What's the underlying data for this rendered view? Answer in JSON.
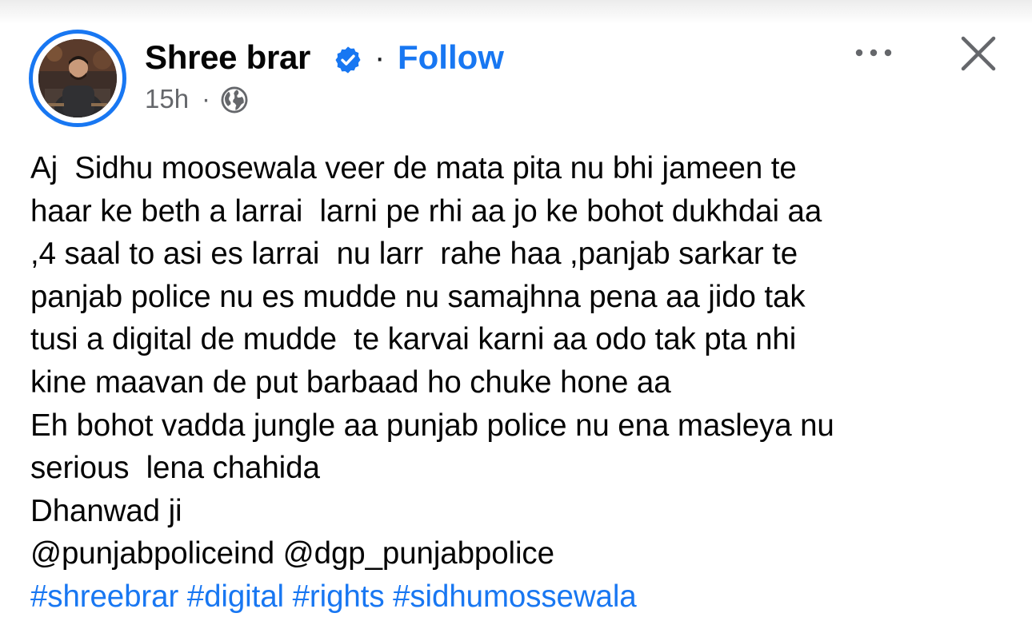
{
  "post": {
    "author": {
      "name": "Shree brar",
      "verified": true,
      "avatar_icon": "profile-photo"
    },
    "follow_label": "Follow",
    "separator": "·",
    "timestamp": "15h",
    "audience_icon": "globe-icon",
    "menu_icon": "more-horizontal-icon",
    "close_icon": "close-icon",
    "body_lines": [
      "Aj  Sidhu moosewala veer de mata pita nu bhi jameen te",
      "haar ke beth a larrai  larni pe rhi aa jo ke bohot dukhdai aa",
      ",4 saal to asi es larrai  nu larr  rahe haa ,panjab sarkar te",
      "panjab police nu es mudde nu samajhna pena aa jido tak",
      "tusi a digital de mudde  te karvai karni aa odo tak pta nhi",
      "kine maavan de put barbaad ho chuke hone aa",
      "Eh bohot vadda jungle aa punjab police nu ena masleya nu",
      "serious  lena chahida",
      "Dhanwad ji",
      "@punjabpoliceind @dgp_punjabpolice"
    ],
    "hashtags": [
      "#shreebrar",
      "#digital",
      "#rights",
      "#sidhumossewala"
    ]
  },
  "colors": {
    "accent": "#1877f2",
    "text": "#050505",
    "muted": "#65676b"
  }
}
